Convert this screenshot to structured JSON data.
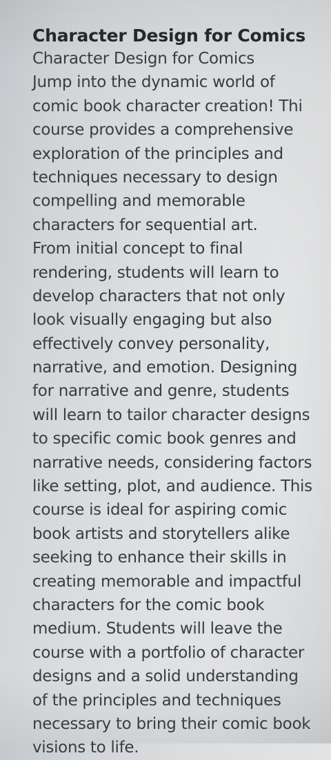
{
  "document": {
    "title": "Character Design for Comics",
    "lines": [
      "Character Design for Comics",
      "Jump into the dynamic world of",
      "comic book character creation! Thi",
      "course provides a comprehensive",
      "exploration of the principles and",
      "techniques necessary to design",
      "compelling and memorable",
      "characters for sequential art.",
      "From initial concept to final",
      "rendering, students will learn to",
      "develop characters that not only",
      "look visually engaging but also",
      "effectively convey personality,",
      "narrative, and emotion. Designing",
      "for narrative and genre, students",
      "will learn to tailor character designs",
      "to specific comic book genres and",
      "narrative needs, considering factors",
      "like setting, plot, and audience. This",
      "course is ideal for aspiring comic",
      "book artists and storytellers alike",
      "seeking to enhance their skills in",
      "creating memorable and impactful",
      "characters for the comic book",
      "medium. Students will leave the",
      "course with a portfolio of character",
      "designs and a solid understanding",
      "of the principles and techniques",
      "necessary to bring their comic book",
      "visions to life."
    ]
  }
}
